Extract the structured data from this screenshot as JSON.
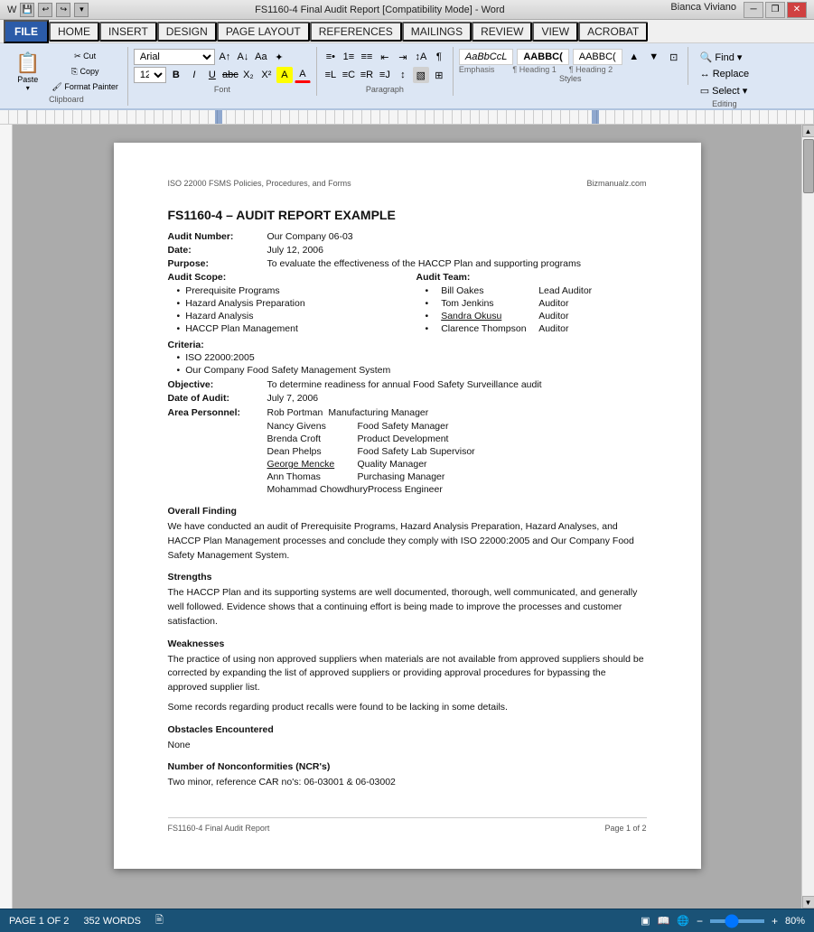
{
  "titleBar": {
    "title": "FS1160-4 Final Audit Report [Compatibility Mode] - Word",
    "leftIcons": [
      "⊞",
      "💾",
      "↩",
      "↪",
      "▼"
    ],
    "minimizeLabel": "─",
    "restoreLabel": "❐",
    "closeLabel": "✕",
    "userLabel": "Bianca Viviano"
  },
  "menuBar": {
    "file": "FILE",
    "items": [
      "HOME",
      "INSERT",
      "DESIGN",
      "PAGE LAYOUT",
      "REFERENCES",
      "MAILINGS",
      "REVIEW",
      "VIEW",
      "ACROBAT"
    ]
  },
  "ribbon": {
    "clipboard": {
      "label": "Clipboard",
      "paste": "Paste",
      "cut": "Cut",
      "copy": "Copy",
      "formatPainter": "Format Painter"
    },
    "font": {
      "label": "Font",
      "fontName": "Arial",
      "fontSize": "12",
      "bold": "B",
      "italic": "I",
      "underline": "U",
      "strikethrough": "abc",
      "subscript": "X₂",
      "superscript": "X²",
      "clearFormat": "A",
      "textHighlight": "A",
      "fontColor": "A"
    },
    "paragraph": {
      "label": "Paragraph",
      "bullets": "≡",
      "numbering": "≡",
      "multilevel": "≡",
      "decreaseIndent": "⇤",
      "increaseIndent": "⇥",
      "sort": "↕",
      "showHide": "¶",
      "alignLeft": "≡",
      "center": "≡",
      "alignRight": "≡",
      "justify": "≡",
      "lineSpacing": "↕",
      "shading": "▧",
      "borders": "⊞"
    },
    "styles": {
      "label": "Styles",
      "items": [
        {
          "name": "Emphasis",
          "label": "AaBbCcL",
          "style": "italic"
        },
        {
          "name": "Heading 1",
          "label": "AABBCC",
          "style": "bold"
        },
        {
          "name": "Heading 2",
          "label": "AABBCC",
          "style": "normal"
        }
      ]
    },
    "editing": {
      "label": "Editing",
      "find": "Find",
      "replace": "Replace",
      "select": "Select"
    }
  },
  "document": {
    "headerLeft": "ISO 22000 FSMS Policies, Procedures, and Forms",
    "headerRight": "Bizmanualz.com",
    "title": "FS1160-4 – AUDIT REPORT EXAMPLE",
    "auditNumber": {
      "label": "Audit Number:",
      "value": "Our Company 06-03"
    },
    "date": {
      "label": "Date:",
      "value": "July 12, 2006"
    },
    "purpose": {
      "label": "Purpose:",
      "value": "To evaluate the effectiveness of the HACCP Plan and supporting programs"
    },
    "auditScope": {
      "label": "Audit Scope:",
      "items": [
        "Prerequisite Programs",
        "Hazard Analysis Preparation",
        "Hazard Analysis",
        "HACCP Plan Management"
      ]
    },
    "auditTeam": {
      "label": "Audit Team:",
      "members": [
        {
          "name": "Bill Oakes",
          "role": "Lead Auditor"
        },
        {
          "name": "Tom Jenkins",
          "role": "Auditor"
        },
        {
          "name": "Sandra Okusu",
          "role": "Auditor"
        },
        {
          "name": "Clarence Thompson",
          "role": "Auditor"
        }
      ]
    },
    "criteria": {
      "label": "Criteria:",
      "items": [
        "ISO 22000:2005",
        "Our Company Food Safety Management System"
      ]
    },
    "objective": {
      "label": "Objective:",
      "value": "To determine readiness for annual Food Safety Surveillance audit"
    },
    "dateOfAudit": {
      "label": "Date of Audit:",
      "value": "July 7, 2006"
    },
    "areaPersonnel": {
      "label": "Area Personnel:",
      "people": [
        {
          "name": "Rob Portman",
          "role": "Manufacturing Manager"
        },
        {
          "name": "Nancy Givens",
          "role": "Food Safety Manager"
        },
        {
          "name": "Brenda Croft",
          "role": "Product Development"
        },
        {
          "name": "Dean Phelps",
          "role": "Food Safety Lab Supervisor"
        },
        {
          "name": "George Mencke",
          "role": "Quality Manager"
        },
        {
          "name": "Ann Thomas",
          "role": "Purchasing Manager"
        },
        {
          "name": "Mohammad Chowdhury",
          "role": "Process Engineer"
        }
      ]
    },
    "overallFinding": {
      "heading": "Overall Finding",
      "text": "We have conducted an audit of Prerequisite Programs, Hazard Analysis Preparation, Hazard Analyses, and HACCP Plan Management processes and conclude they comply with ISO 22000:2005 and Our Company Food Safety Management System."
    },
    "strengths": {
      "heading": "Strengths",
      "text": "The HACCP Plan and its supporting systems are well documented, thorough, well communicated, and generally well followed. Evidence shows that a continuing effort is being made to improve the processes and customer satisfaction."
    },
    "weaknesses": {
      "heading": "Weaknesses",
      "text1": "The practice of using non approved suppliers when materials are not available from approved suppliers should be corrected by expanding the list of approved suppliers or providing approval procedures for bypassing the approved supplier list.",
      "text2": "Some records regarding product recalls were found to be lacking in some details."
    },
    "obstacles": {
      "heading": "Obstacles Encountered",
      "text": "None"
    },
    "nonconformities": {
      "heading": "Number of Nonconformities (NCR's)",
      "text": "Two minor, reference CAR no's: 06-03001 & 06-03002"
    },
    "footerLeft": "FS1160-4 Final Audit Report",
    "footerRight": "Page 1 of 2"
  },
  "statusBar": {
    "pages": "PAGE 1 OF 2",
    "words": "352 WORDS",
    "lang": "🖹",
    "zoom": "80%",
    "zoomOut": "−",
    "zoomIn": "+"
  }
}
